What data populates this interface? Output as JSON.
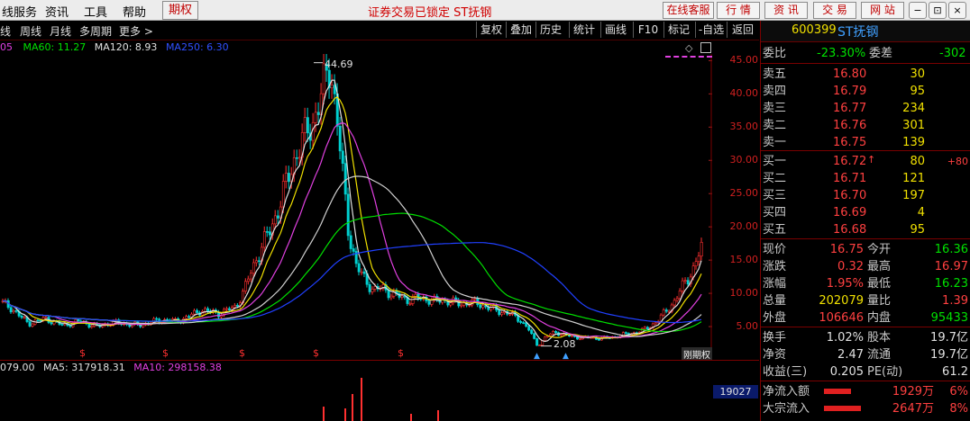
{
  "menubar": {
    "items": [
      "线服务",
      "资讯",
      "工具",
      "帮助"
    ],
    "options_button": "期权",
    "notice": "证券交易已锁定  ST抚钢",
    "right_buttons": [
      "在线客服",
      "行  情",
      "资  讯",
      "交  易",
      "网  站"
    ],
    "window_buttons": [
      "−",
      "⊡",
      "×"
    ]
  },
  "toolbar": {
    "left_items": [
      "线",
      "周线",
      "月线",
      "多周期",
      "更多 >"
    ],
    "right_items": [
      "复权",
      "叠加",
      "历史",
      "统计",
      "画线",
      "F10",
      "标记",
      "-自选",
      "返回"
    ]
  },
  "ma_legend": [
    {
      "text": "05",
      "color": "#e040e0"
    },
    {
      "text": "MA60: 11.27",
      "color": "#00e000"
    },
    {
      "text": "MA120: 8.93",
      "color": "#e0e0e0"
    },
    {
      "text": "MA250: 6.30",
      "color": "#3050ff"
    }
  ],
  "vol_legend": [
    {
      "text": "079.00",
      "color": "#e0e0e0"
    },
    {
      "text": "MA5: 317918.31",
      "color": "#e0e0e0"
    },
    {
      "text": "MA10: 298158.38",
      "color": "#e040e0"
    }
  ],
  "yaxis_labels": [
    "45.00",
    "40.00",
    "35.00",
    "30.00",
    "25.00",
    "20.00",
    "15.00",
    "10.00",
    "5.00"
  ],
  "chart_annotations": {
    "high": "44.69",
    "low": "2.08",
    "watermark": "刚期权"
  },
  "vol_value": "19027",
  "quote_panel": {
    "code": "600399",
    "name": "ST抚钢",
    "weibi_label": "委比",
    "weibi_value": "-23.30%",
    "weicha_label": "委差",
    "weicha_value": "-302",
    "asks": [
      {
        "label": "卖五",
        "price": "16.80",
        "vol": "30"
      },
      {
        "label": "卖四",
        "price": "16.79",
        "vol": "95"
      },
      {
        "label": "卖三",
        "price": "16.77",
        "vol": "234"
      },
      {
        "label": "卖二",
        "price": "16.76",
        "vol": "301"
      },
      {
        "label": "卖一",
        "price": "16.75",
        "vol": "139"
      }
    ],
    "bids": [
      {
        "label": "买一",
        "price": "16.72",
        "vol": "80",
        "extra": "+80"
      },
      {
        "label": "买二",
        "price": "16.71",
        "vol": "121",
        "extra": ""
      },
      {
        "label": "买三",
        "price": "16.70",
        "vol": "197",
        "extra": ""
      },
      {
        "label": "买四",
        "price": "16.69",
        "vol": "4",
        "extra": ""
      },
      {
        "label": "买五",
        "price": "16.68",
        "vol": "95",
        "extra": ""
      }
    ],
    "stats": [
      {
        "l1": "现价",
        "v1": "16.75",
        "c1": "red",
        "l2": "今开",
        "v2": "16.36",
        "c2": "green"
      },
      {
        "l1": "涨跌",
        "v1": "0.32",
        "c1": "red",
        "l2": "最高",
        "v2": "16.97",
        "c2": "red"
      },
      {
        "l1": "涨幅",
        "v1": "1.95%",
        "c1": "red",
        "l2": "最低",
        "v2": "16.23",
        "c2": "green"
      },
      {
        "l1": "总量",
        "v1": "202079",
        "c1": "yel",
        "l2": "量比",
        "v2": "1.39",
        "c2": "red"
      },
      {
        "l1": "外盘",
        "v1": "106646",
        "c1": "red",
        "l2": "内盘",
        "v2": "95433",
        "c2": "green"
      }
    ],
    "stats2": [
      {
        "l1": "换手",
        "v1": "1.02%",
        "l2": "股本",
        "v2": "19.7亿"
      },
      {
        "l1": "净资",
        "v1": "2.47",
        "l2": "流通",
        "v2": "19.7亿"
      },
      {
        "l1": "收益(三)",
        "v1": "0.205",
        "l2": "PE(动)",
        "v2": "61.2"
      }
    ],
    "flows": [
      {
        "label": "净流入额",
        "value": "1929万",
        "pct": "6%",
        "bar": 0.6
      },
      {
        "label": "大宗流入",
        "value": "2647万",
        "pct": "8%",
        "bar": 0.82
      }
    ]
  },
  "chart_data": {
    "type": "candlestick",
    "title": "",
    "ylabel": "",
    "ylim": [
      0,
      46
    ],
    "yticks": [
      5,
      10,
      15,
      20,
      25,
      30,
      35,
      40,
      45
    ],
    "annotations": [
      {
        "label": "44.69",
        "value": 44.69
      },
      {
        "label": "2.08",
        "value": 2.08
      }
    ],
    "approx_close_series": [
      8.5,
      7.8,
      6.5,
      5.5,
      5.8,
      6.2,
      5.6,
      5.2,
      5.5,
      5.8,
      5.3,
      5.0,
      5.4,
      5.6,
      5.5,
      5.2,
      5.3,
      5.6,
      5.9,
      6.0,
      5.8,
      6.2,
      6.8,
      7.5,
      7.2,
      7.0,
      7.4,
      8.0,
      10.5,
      14.0,
      17.0,
      19.5,
      23.0,
      27.0,
      31.0,
      33.5,
      36.0,
      40.0,
      44.69,
      33.0,
      20.0,
      14.0,
      12.0,
      10.5,
      10.8,
      10.0,
      9.5,
      9.0,
      9.3,
      9.2,
      8.8,
      9.0,
      8.7,
      8.4,
      8.6,
      8.5,
      8.0,
      7.5,
      7.2,
      6.8,
      6.0,
      4.5,
      2.08,
      3.5,
      4.2,
      3.8,
      3.5,
      3.3,
      3.4,
      3.2,
      3.3,
      3.5,
      3.8,
      4.0,
      4.3,
      5.0,
      6.0,
      7.5,
      9.0,
      11.5,
      13.5,
      16.75
    ],
    "series": [
      {
        "name": "MA60",
        "value": 11.27
      },
      {
        "name": "MA120",
        "value": 8.93
      },
      {
        "name": "MA250",
        "value": 6.3
      }
    ]
  }
}
